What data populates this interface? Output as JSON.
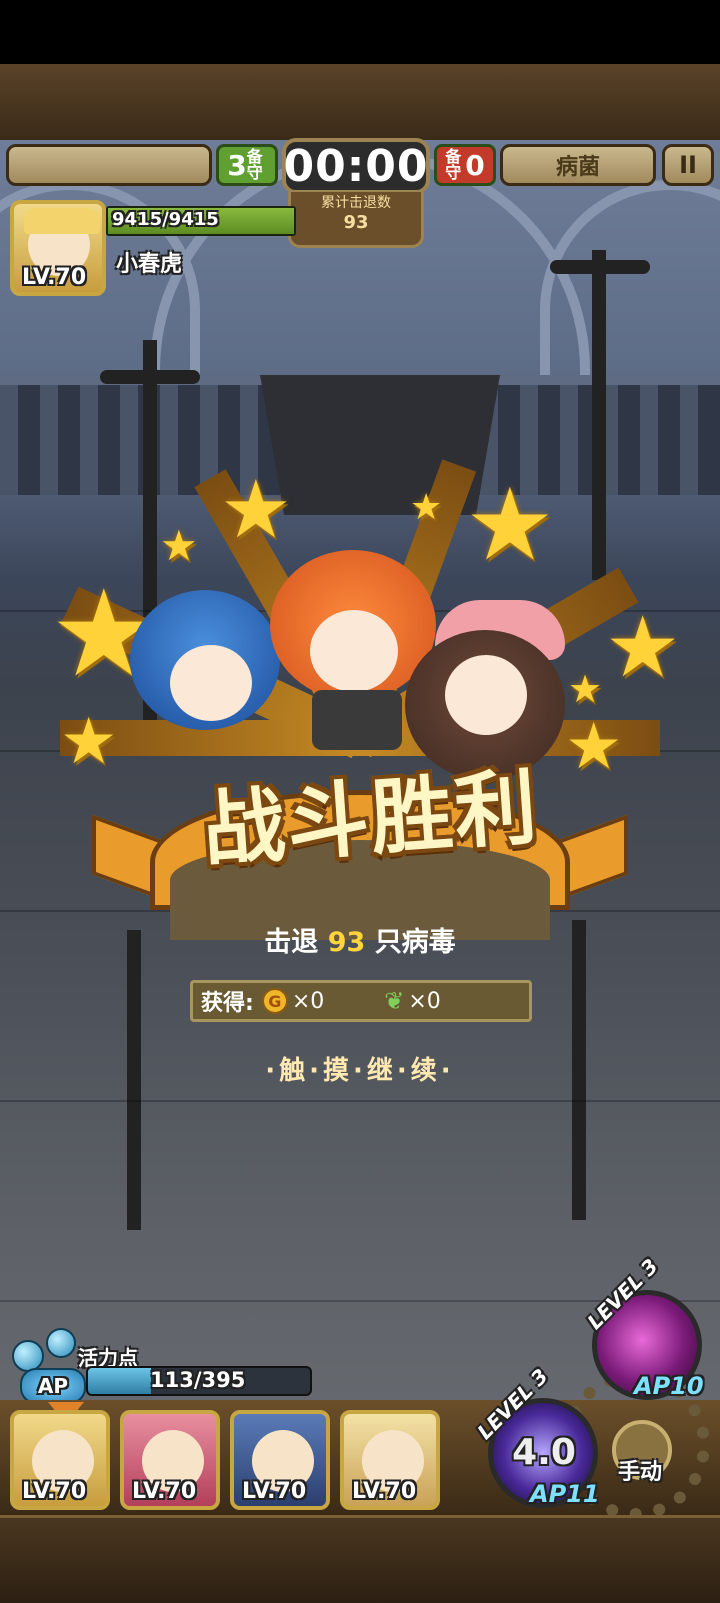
{
  "top_bar": {
    "team_left_count": "3",
    "team_left_label": "备守",
    "timer": "00:00",
    "kill_label": "累计击退数",
    "kill_count": "93",
    "team_right_label": "备守",
    "team_right_count": "0",
    "enemy_name": "病菌",
    "pause_symbol": "II"
  },
  "player": {
    "hp": "9415/9415",
    "name": "小春虎",
    "level": "LV.70",
    "hp_fraction": 1.0
  },
  "result": {
    "title": "战斗胜利",
    "defeat_prefix": "击退",
    "defeat_count": "93",
    "defeat_suffix": "只病毒",
    "reward_label": "获得:",
    "coin_symbol": "G",
    "coin_amount": "×0",
    "item_amount": "×0",
    "continue_text": "·触·摸·继·续·"
  },
  "ap": {
    "label": "活力点",
    "badge": "AP",
    "value": "113/395",
    "fraction": 0.286
  },
  "party": [
    {
      "level": "LV.70"
    },
    {
      "level": "LV.70"
    },
    {
      "level": "LV.70"
    },
    {
      "level": "LV.70"
    }
  ],
  "skills": {
    "skill_top": {
      "level": "LEVEL 3",
      "ap": "AP10"
    },
    "skill_main": {
      "level": "LEVEL 3",
      "speed": "4.0",
      "ap": "AP11"
    },
    "manual_label": "手动"
  },
  "colors": {
    "accent_gold": "#ffd23a",
    "hp_green": "#6aa02c",
    "ap_blue": "#3c8fb5",
    "team_red": "#c33a2a"
  }
}
